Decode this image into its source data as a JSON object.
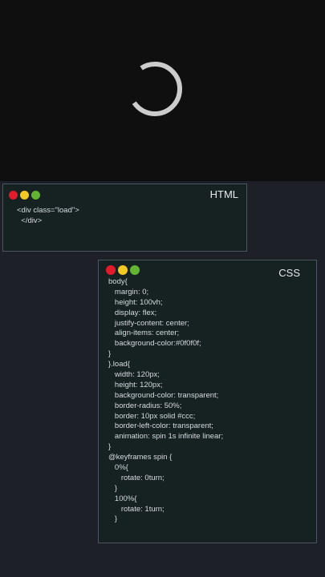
{
  "preview": {
    "background": "#0f0f0f",
    "spinner": {
      "color": "#cccccc",
      "arc": "three-quarter ring, left side transparent"
    }
  },
  "html_panel": {
    "title": "HTML",
    "lines": [
      "<div class=\"load\">",
      "  </div>"
    ]
  },
  "css_panel": {
    "title": "CSS",
    "lines": [
      "body{",
      "   margin: 0;",
      "   height: 100vh;",
      "   display: flex;",
      "   justify-content: center;",
      "   align-items: center;",
      "   background-color:#0f0f0f;",
      "}",
      "}.load{",
      "   width: 120px;",
      "   height: 120px;",
      "   background-color: transparent;",
      "   border-radius: 50%;",
      "   border: 10px solid #ccc;",
      "   border-left-color: transparent;",
      "   animation: spin 1s infinite linear;",
      "}",
      "@keyframes spin {",
      "   0%{",
      "      rotate: 0turn;",
      "   }",
      "   100%{",
      "      rotate: 1turn;",
      "   }"
    ]
  },
  "window_dots": {
    "red": "#e21b2c",
    "yellow": "#f2c823",
    "green": "#63b531"
  }
}
